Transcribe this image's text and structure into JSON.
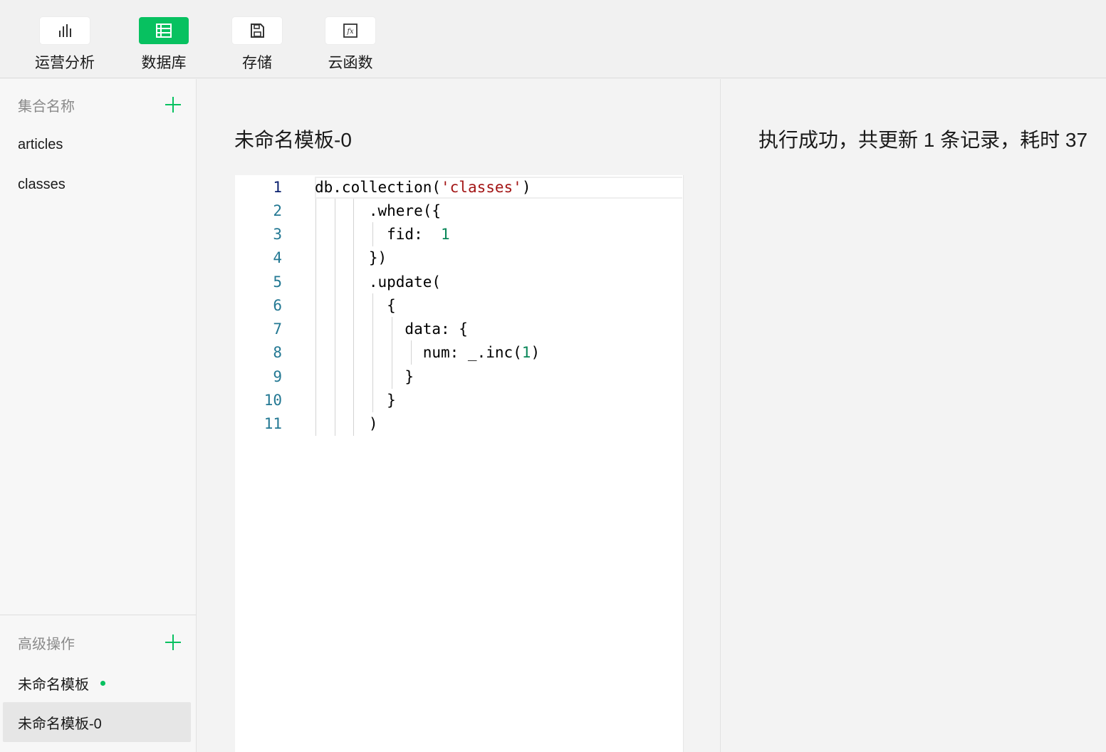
{
  "toolbar": {
    "items": [
      {
        "label": "运营分析",
        "icon": "bar-chart-icon",
        "active": false
      },
      {
        "label": "数据库",
        "icon": "database-table-icon",
        "active": true
      },
      {
        "label": "存储",
        "icon": "save-disk-icon",
        "active": false
      },
      {
        "label": "云函数",
        "icon": "function-fx-icon",
        "active": false
      }
    ]
  },
  "sidebar": {
    "collections_header": "集合名称",
    "collections": [
      "articles",
      "classes"
    ],
    "advanced_header": "高级操作",
    "templates": [
      {
        "label": "未命名模板",
        "unsaved_dot": true
      },
      {
        "label": "未命名模板-0",
        "selected": true
      }
    ]
  },
  "editor": {
    "title": "未命名模板-0",
    "current_line": 1,
    "lines": [
      {
        "n": "1",
        "text": "db.collection('classes')"
      },
      {
        "n": "2",
        "text": "      .where({"
      },
      {
        "n": "3",
        "text": "        fid:  1"
      },
      {
        "n": "4",
        "text": "      })"
      },
      {
        "n": "5",
        "text": "      .update("
      },
      {
        "n": "6",
        "text": "        {"
      },
      {
        "n": "7",
        "text": "          data: {"
      },
      {
        "n": "8",
        "text": "            num: _.inc(1)"
      },
      {
        "n": "9",
        "text": "          }"
      },
      {
        "n": "10",
        "text": "        }"
      },
      {
        "n": "11",
        "text": "      )"
      }
    ]
  },
  "result": {
    "message": "执行成功，共更新 1 条记录，耗时 37"
  },
  "colors": {
    "accent": "#07c160",
    "line_number": "#237893",
    "string": "#a31515",
    "number": "#098658"
  }
}
